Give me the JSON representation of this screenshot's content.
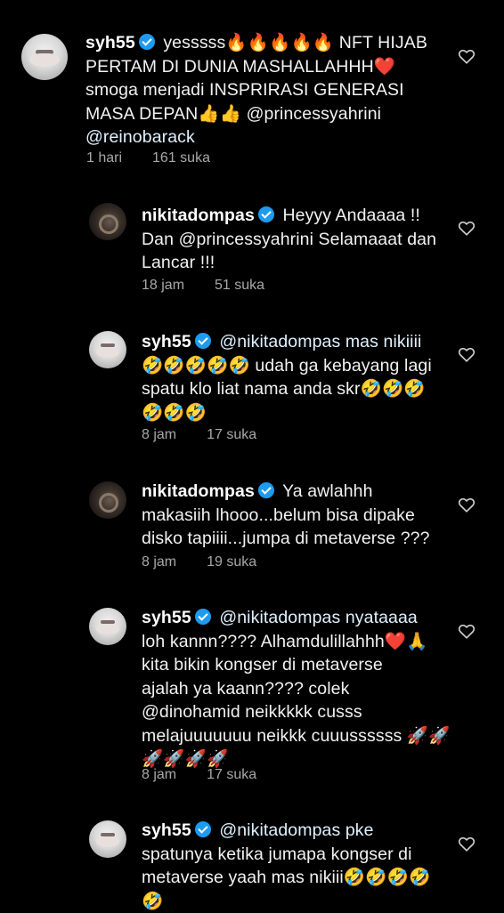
{
  "comments": [
    {
      "username": "syh55",
      "avatar": "syh",
      "lines": [
        "yesssss🔥🔥🔥🔥🔥 NFT HIJAB",
        "PERTAM DI DUNIA  MASHALLAHHH❤️",
        "smoga menjadi INSPRIRASI GENERASI",
        "MASA DEPAN👍👍 @princessyahrini",
        "@reinobarack"
      ],
      "time": "1 hari",
      "likes": "161 suka"
    },
    {
      "username": "nikitadompas",
      "avatar": "nikita",
      "lines": [
        "Heyyy Andaaaa !!",
        "Dan @princessyahrini Selamaaat dan",
        "Lancar !!!"
      ],
      "time": "18 jam",
      "likes": "51 suka"
    },
    {
      "username": "syh55",
      "avatar": "syh",
      "lines": [
        "@nikitadompas mas nikiiii",
        "🤣🤣🤣🤣🤣 udah ga kebayang lagi",
        "spatu klo liat nama anda skr🤣🤣🤣",
        "🤣🤣🤣"
      ],
      "time": "8 jam",
      "likes": "17 suka"
    },
    {
      "username": "nikitadompas",
      "avatar": "nikita",
      "lines": [
        "Ya awlahhh",
        "makasiih lhooo...belum bisa dipake",
        "disko tapiiii...jumpa di metaverse ???"
      ],
      "time": "8 jam",
      "likes": "19 suka"
    },
    {
      "username": "syh55",
      "avatar": "syh",
      "lines": [
        "@nikitadompas nyataaaa",
        "loh kannn???? Alhamdulillahhh❤️🙏",
        "kita bikin kongser di metaverse",
        "ajalah ya kaann???? colek",
        "@dinohamid neikkkkk cusss",
        "melajuuuuuuu neikkk cuuussssss 🚀🚀",
        "🚀🚀🚀🚀"
      ],
      "time": "8 jam",
      "likes": "17 suka"
    },
    {
      "username": "syh55",
      "avatar": "syh",
      "lines": [
        "@nikitadompas pke",
        "spatunya ketika jumapa kongser di",
        "metaverse yaah mas nikiii🤣🤣🤣🤣",
        "🤣"
      ],
      "time": "",
      "likes": ""
    }
  ],
  "icons": {
    "like": "heart-outline-icon",
    "verified": "verified-badge-icon"
  },
  "colors": {
    "background": "#000000",
    "verified": "#1d9bf0",
    "meta": "#a8a8a8"
  }
}
